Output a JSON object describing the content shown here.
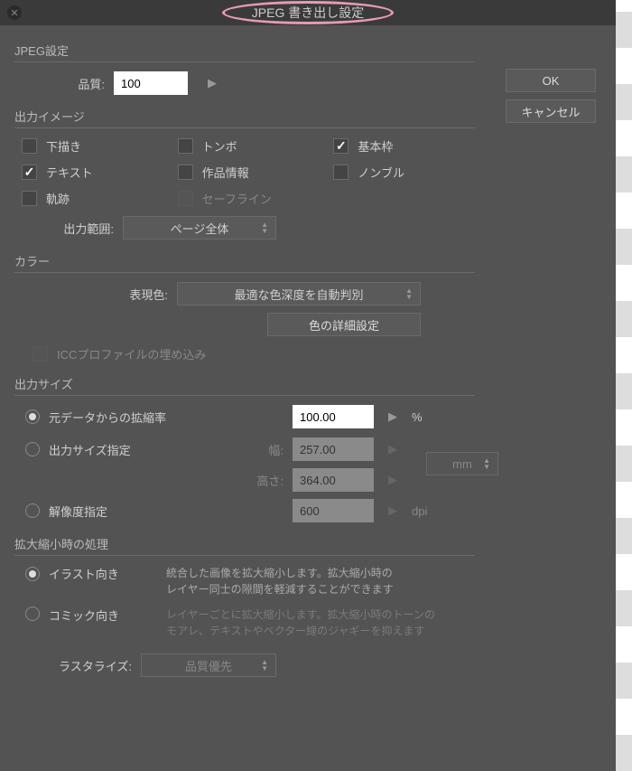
{
  "title": "JPEG 書き出し設定",
  "buttons": {
    "ok": "OK",
    "cancel": "キャンセル"
  },
  "jpeg": {
    "section": "JPEG設定",
    "quality_label": "品質:",
    "quality_value": "100"
  },
  "output_image": {
    "section": "出力イメージ",
    "draft": "下描き",
    "tombo": "トンボ",
    "base_frame": "基本枠",
    "text": "テキスト",
    "work_info": "作品情報",
    "nombre": "ノンブル",
    "trajectory": "軌跡",
    "safe_line": "セーフライン",
    "output_range_label": "出力範囲:",
    "output_range_value": "ページ全体"
  },
  "color": {
    "section": "カラー",
    "expr_label": "表現色:",
    "expr_value": "最適な色深度を自動判別",
    "detail_btn": "色の詳細設定",
    "icc_label": "ICCプロファイルの埋め込み"
  },
  "output_size": {
    "section": "出力サイズ",
    "scale_from_original": "元データからの拡縮率",
    "scale_value": "100.00",
    "percent": "%",
    "specify_size": "出力サイズ指定",
    "width_label": "幅:",
    "width_value": "257.00",
    "height_label": "高さ:",
    "height_value": "364.00",
    "unit_mm": "mm",
    "resolution": "解像度指定",
    "resolution_value": "600",
    "dpi": "dpi"
  },
  "scaling": {
    "section": "拡大縮小時の処理",
    "illust": "イラスト向き",
    "illust_desc1": "統合した画像を拡大縮小します。拡大縮小時の",
    "illust_desc2": "レイヤー同士の隙間を軽減することができます",
    "comic": "コミック向き",
    "comic_desc1": "レイヤーごとに拡大縮小します。拡大縮小時のトーンの",
    "comic_desc2": "モアレ、テキストやベクター線のジャギーを抑えます",
    "rasterize_label": "ラスタライズ:",
    "rasterize_value": "品質優先"
  }
}
